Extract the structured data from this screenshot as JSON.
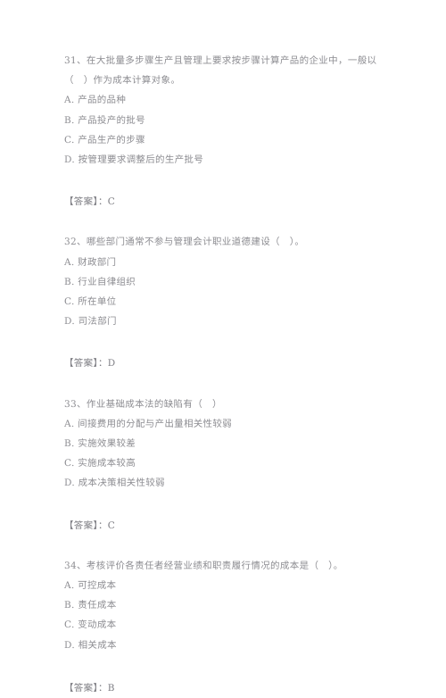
{
  "document": {
    "type": "exam-question-sheet",
    "language": "zh-CN",
    "background_color": "#ffffff",
    "text_color": "#8d8d92"
  },
  "answer_label": "【答案】：",
  "questions": [
    {
      "number": "31",
      "stem": "31、在大批量多步骤生产且管理上要求按步骤计算产品的企业中，一般以（　）作为成本计算对象。",
      "options": [
        "A. 产品的品种",
        "B. 产品投产的批号",
        "C. 产品生产的步骤",
        "D. 按管理要求调整后的生产批号"
      ],
      "answer": "C",
      "answer_text": "【答案】：C"
    },
    {
      "number": "32",
      "stem": "32、哪些部门通常不参与管理会计职业道德建设（　）。",
      "options": [
        "A. 财政部门",
        "B. 行业自律组织",
        "C. 所在单位",
        "D. 司法部门"
      ],
      "answer": "D",
      "answer_text": "【答案】：D"
    },
    {
      "number": "33",
      "stem": "33、作业基础成本法的缺陷有（　）",
      "options": [
        "A. 间接费用的分配与产出量相关性较弱",
        "B. 实施效果较差",
        "C. 实施成本较高",
        "D. 成本决策相关性较弱"
      ],
      "answer": "C",
      "answer_text": "【答案】：C"
    },
    {
      "number": "34",
      "stem": "34、考核评价各责任者经营业绩和职责履行情况的成本是（　）。",
      "options": [
        "A. 可控成本",
        "B. 责任成本",
        "C. 变动成本",
        "D. 相关成本"
      ],
      "answer": "B",
      "answer_text": "【答案】：B"
    }
  ]
}
